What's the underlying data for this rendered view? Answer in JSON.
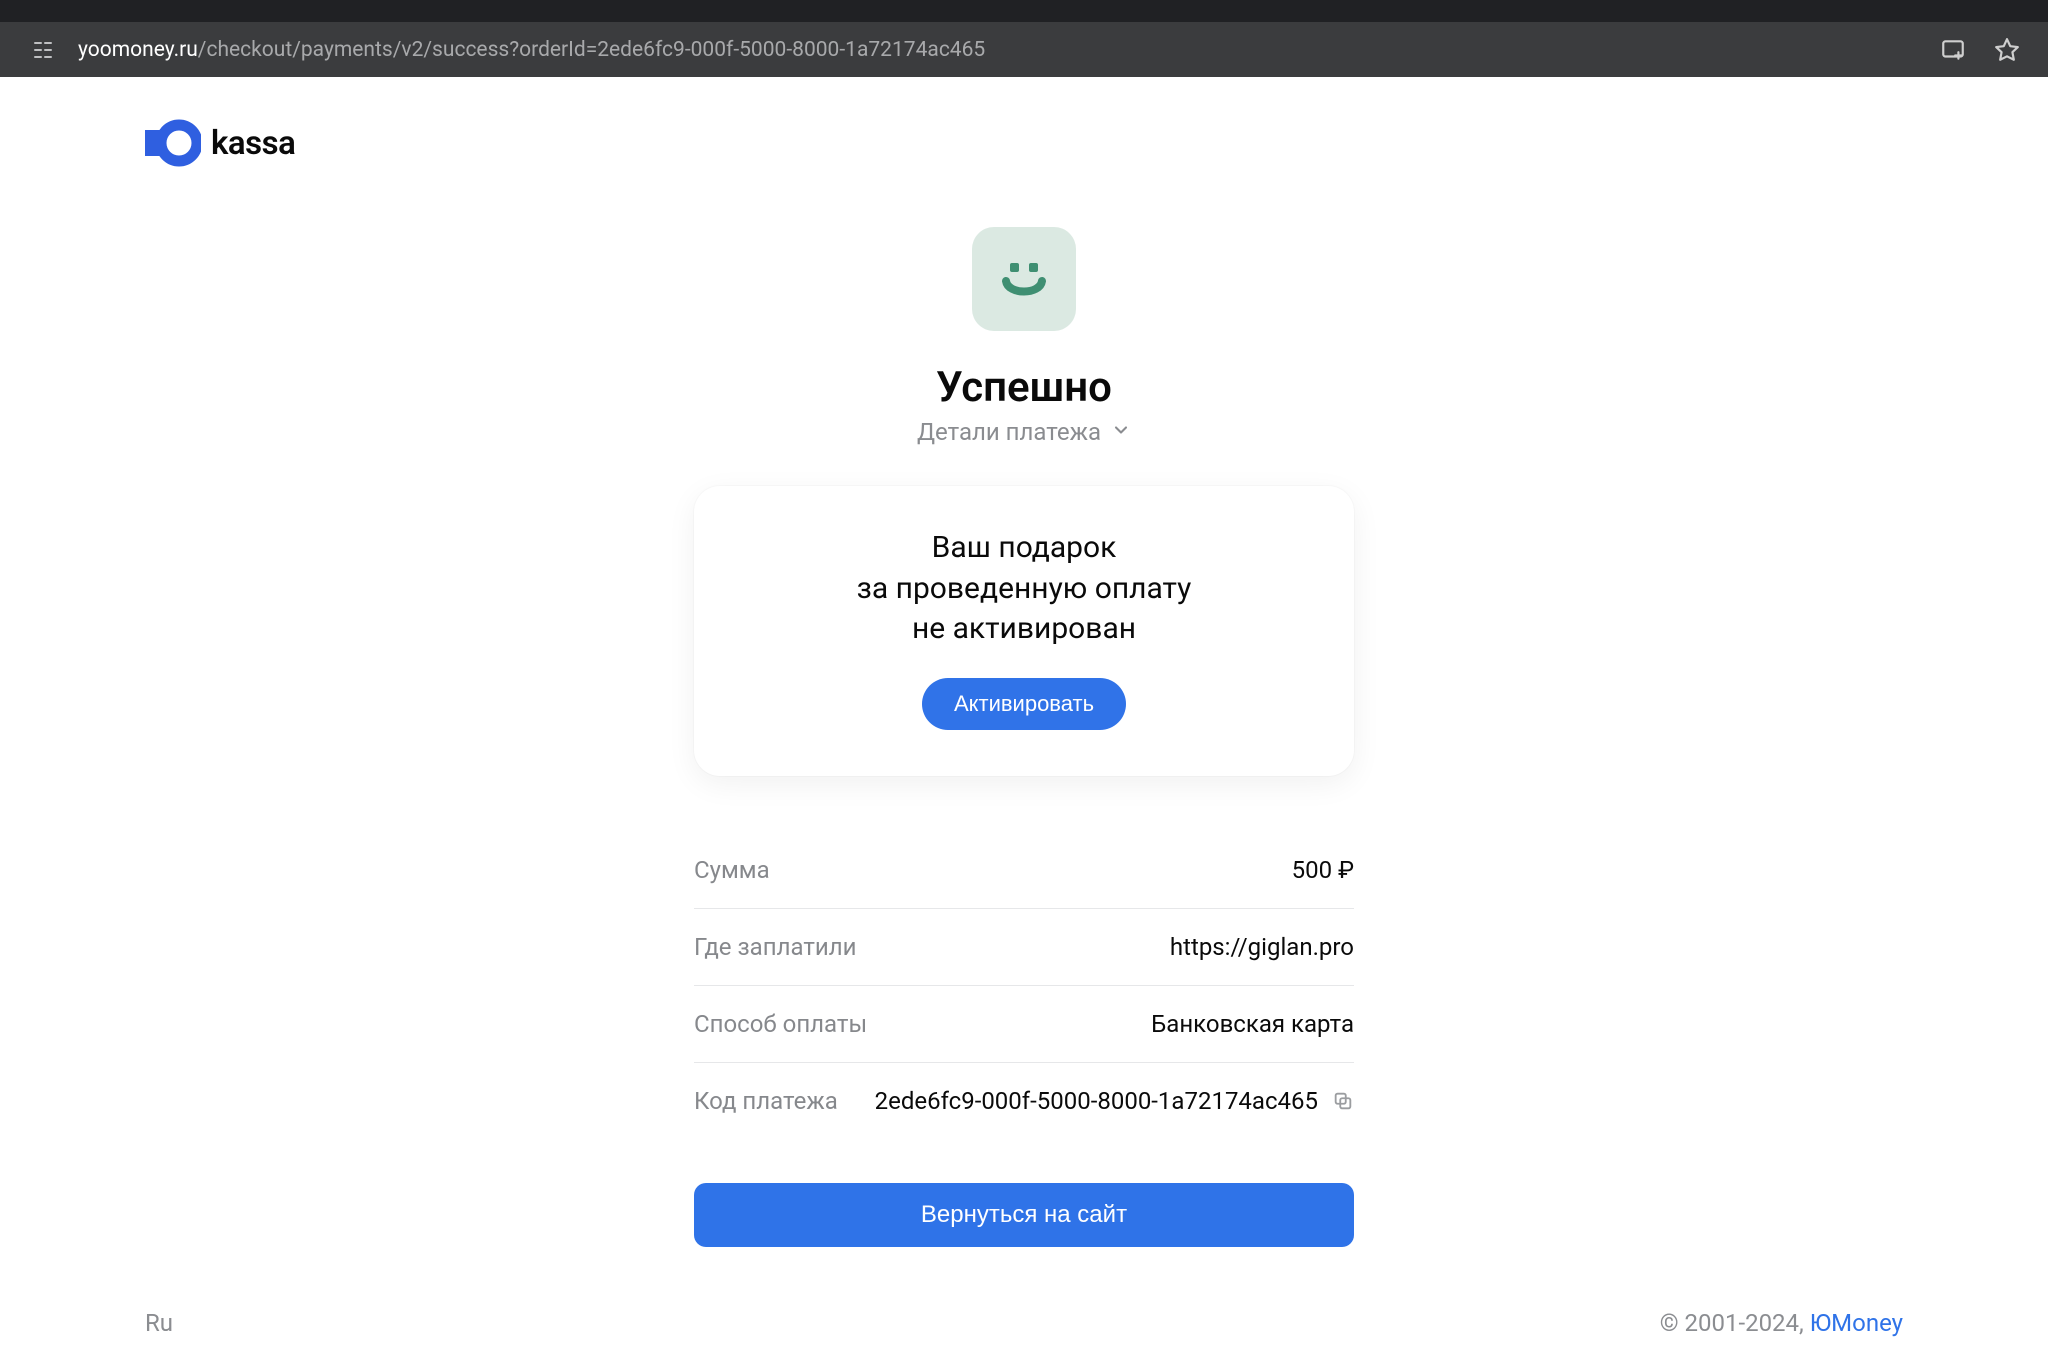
{
  "browser": {
    "url_domain": "yoomoney.ru",
    "url_path": "/checkout/payments/v2/success?orderId=2ede6fc9-000f-5000-8000-1a72174ac465"
  },
  "logo": {
    "text": "kassa"
  },
  "success": {
    "title": "Успешно",
    "details_toggle": "Детали платежа"
  },
  "gift": {
    "line1": "Ваш подарок",
    "line2": "за проведенную оплату",
    "line3": "не активирован",
    "button": "Активировать"
  },
  "details": {
    "amount": {
      "label": "Сумма",
      "value": "500 ₽"
    },
    "merchant": {
      "label": "Где заплатили",
      "value": "https://giglan.pro"
    },
    "method": {
      "label": "Способ оплаты",
      "value": "Банковская карта"
    },
    "code": {
      "label": "Код платежа",
      "value": "2ede6fc9-000f-5000-8000-1a72174ac465"
    }
  },
  "return_button": "Вернуться на сайт",
  "footer": {
    "lang": "Ru",
    "copyright_prefix": "© 2001-2024, ",
    "brand": "ЮMoney"
  }
}
